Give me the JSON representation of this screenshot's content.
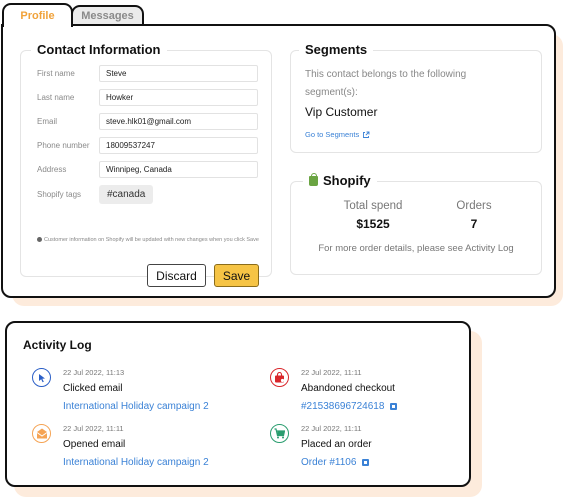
{
  "tabs": [
    {
      "label": "Profile",
      "active": true
    },
    {
      "label": "Messages",
      "active": false
    }
  ],
  "contact": {
    "title": "Contact Information",
    "fields": [
      {
        "label": "First name",
        "value": "Steve"
      },
      {
        "label": "Last name",
        "value": "Howker"
      },
      {
        "label": "Email",
        "value": "steve.hlk01@gmail.com"
      },
      {
        "label": "Phone number",
        "value": "18009537247"
      },
      {
        "label": "Address",
        "value": "Winnipeg, Canada"
      }
    ],
    "tags_label": "Shopify tags",
    "tags": [
      "#canada"
    ],
    "note": "Customer information on Shopify will be updated with new changes when you click Save",
    "discard_label": "Discard",
    "save_label": "Save"
  },
  "segments": {
    "title": "Segments",
    "description": "This contact belongs to the following segment(s):",
    "segment_name": "Vip Customer",
    "link_label": "Go to Segments"
  },
  "shopify": {
    "title": "Shopify",
    "total_spend_label": "Total spend",
    "total_spend_value": "$1525",
    "orders_label": "Orders",
    "orders_value": "7",
    "note": "For more order details, please see Activity Log"
  },
  "activity": {
    "title": "Activity Log",
    "items": [
      {
        "time": "22 Jul 2022, 11:13",
        "event": "Clicked email",
        "link": "International Holiday campaign 2",
        "icon": "cursor-click-icon",
        "color": "#2b5fc7",
        "external": false
      },
      {
        "time": "22 Jul 2022, 11:11",
        "event": "Opened email",
        "link": "International Holiday campaign 2",
        "icon": "open-envelope-icon",
        "color": "#f5a455",
        "external": false
      },
      {
        "time": "22 Jul 2022, 11:11",
        "event": "Abandoned checkout",
        "link": "#21538696724618",
        "icon": "abandoned-bag-icon",
        "color": "#d9262b",
        "external": true
      },
      {
        "time": "22 Jul 2022, 11:11",
        "event": "Placed an order",
        "link": "Order #1106",
        "icon": "shopping-cart-icon",
        "color": "#2a9d6f",
        "external": true
      }
    ]
  },
  "colors": {
    "accent_orange": "#f0a23a",
    "save_yellow": "#f6c445",
    "link_blue": "#3b82d6",
    "shadow_peach": "#fdebdc"
  }
}
